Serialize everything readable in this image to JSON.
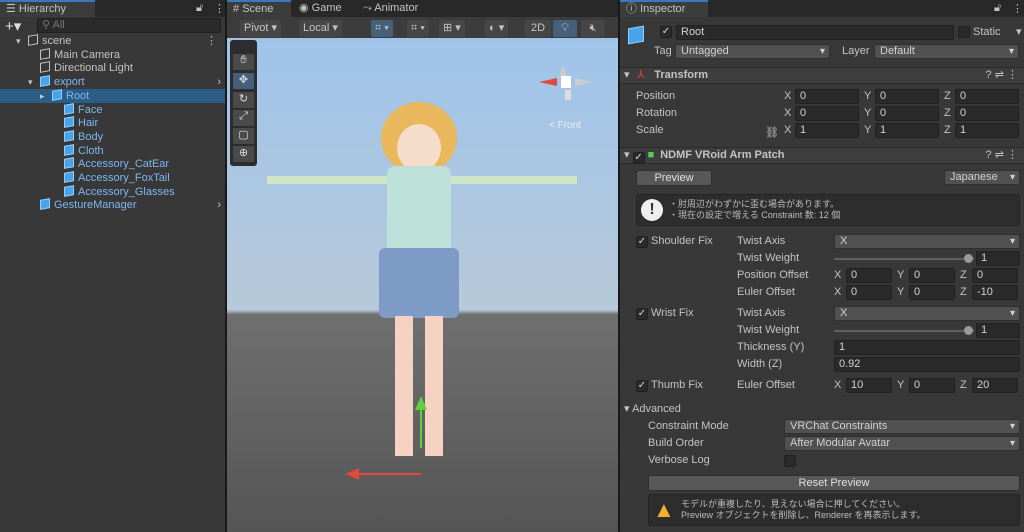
{
  "hierarchy": {
    "title": "Hierarchy",
    "search_placeholder": "All",
    "items": [
      {
        "label": "scene",
        "depth": 0,
        "icon": "unity-scene-icon"
      },
      {
        "label": "Main Camera",
        "depth": 1,
        "icon": "cube-icon"
      },
      {
        "label": "Directional Light",
        "depth": 1,
        "icon": "cube-icon"
      },
      {
        "label": "export",
        "depth": 1,
        "icon": "prefab-icon",
        "prefab": true
      },
      {
        "label": "Root",
        "depth": 2,
        "icon": "prefab-icon",
        "prefab": true,
        "selected": true
      },
      {
        "label": "Face",
        "depth": 3,
        "icon": "cube-icon",
        "prefab": true
      },
      {
        "label": "Hair",
        "depth": 3,
        "icon": "cube-icon",
        "prefab": true
      },
      {
        "label": "Body",
        "depth": 3,
        "icon": "cube-icon",
        "prefab": true
      },
      {
        "label": "Cloth",
        "depth": 3,
        "icon": "cube-icon",
        "prefab": true
      },
      {
        "label": "Accessory_CatEar",
        "depth": 3,
        "icon": "cube-icon",
        "prefab": true
      },
      {
        "label": "Accessory_FoxTail",
        "depth": 3,
        "icon": "cube-icon",
        "prefab": true
      },
      {
        "label": "Accessory_Glasses",
        "depth": 3,
        "icon": "cube-icon",
        "prefab": true
      },
      {
        "label": "GestureManager",
        "depth": 1,
        "icon": "prefab-icon",
        "prefab": true
      }
    ]
  },
  "scene": {
    "tabs": [
      "Scene",
      "Game",
      "Animator"
    ],
    "pivot": "Pivot",
    "local": "Local",
    "mode_2d": "2D",
    "front_label": "< Front"
  },
  "inspector": {
    "title": "Inspector",
    "name": "Root",
    "static_label": "Static",
    "tag_label": "Tag",
    "tag": "Untagged",
    "layer_label": "Layer",
    "layer": "Default",
    "transform": {
      "title": "Transform",
      "rows": [
        {
          "label": "Position",
          "x": "0",
          "y": "0",
          "z": "0"
        },
        {
          "label": "Rotation",
          "x": "0",
          "y": "0",
          "z": "0"
        },
        {
          "label": "Scale",
          "x": "1",
          "y": "1",
          "z": "1"
        }
      ]
    },
    "patch": {
      "title": "NDMF VRoid Arm Patch",
      "preview": "Preview",
      "language": "Japanese",
      "info1": "・肘周辺がわずかに歪む場合があります。",
      "info2": "・現在の設定で増える Constraint 数: 12 個",
      "shoulder_fix": "Shoulder Fix",
      "wrist_fix": "Wrist Fix",
      "thumb_fix": "Thumb Fix",
      "twist_axis": "Twist Axis",
      "twist_axis_value": "X",
      "twist_weight": "Twist Weight",
      "twist_weight_value": "1",
      "position_offset": "Position Offset",
      "euler_offset": "Euler Offset",
      "sh_pos": {
        "x": "0",
        "y": "0",
        "z": "0"
      },
      "sh_euler": {
        "x": "0",
        "y": "0",
        "z": "-10"
      },
      "wr_twist_axis": "X",
      "wr_twist_weight": "1",
      "thickness_label": "Thickness (Y)",
      "thickness": "1",
      "width_label": "Width (Z)",
      "width": "0.92",
      "thumb_euler": {
        "x": "10",
        "y": "0",
        "z": "20"
      },
      "advanced": "Advanced",
      "constraint_mode_label": "Constraint Mode",
      "constraint_mode": "VRChat Constraints",
      "build_order_label": "Build Order",
      "build_order": "After Modular Avatar",
      "verbose_label": "Verbose Log",
      "reset_preview": "Reset Preview",
      "warn1": "モデルが重複したり、見えない場合に押してください。",
      "warn2": "Preview オブジェクトを削除し、Renderer を再表示します。"
    },
    "axis": {
      "x": "X",
      "y": "Y",
      "z": "Z"
    }
  }
}
